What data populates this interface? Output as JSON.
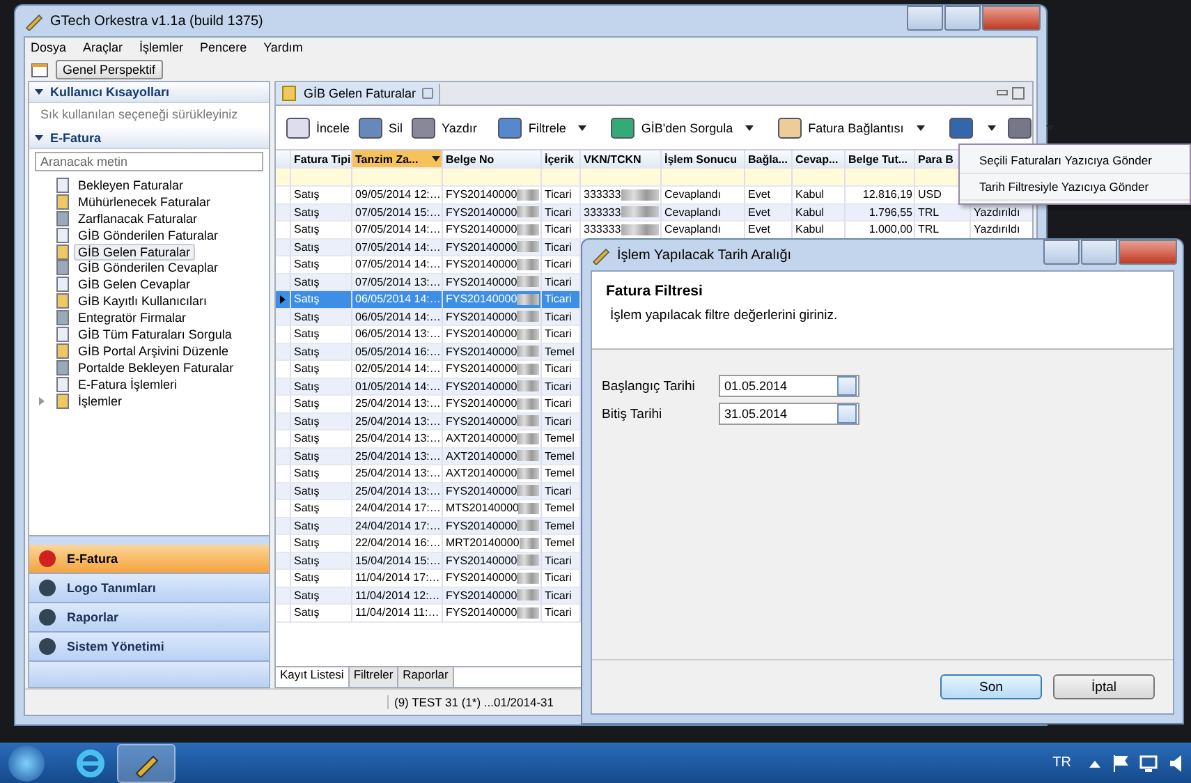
{
  "main_window": {
    "title": "GTech Orkestra v1.1a (build 1375)",
    "menu": [
      "Dosya",
      "Araçlar",
      "İşlemler",
      "Pencere",
      "Yardım"
    ],
    "perspective_button": "Genel Perspektif",
    "sidebar": {
      "shortcuts": {
        "title": "Kullanıcı Kısayolları",
        "expanded": true,
        "hint": "Sık kullanılan seçeneği sürükleyiniz"
      },
      "efatura": {
        "title": "E-Fatura",
        "expanded": true,
        "search": {
          "placeholder": "Aranacak metin"
        },
        "items": [
          {
            "label": "Bekleyen Faturalar",
            "selected": false
          },
          {
            "label": "Mühürlenecek Faturalar",
            "selected": false
          },
          {
            "label": "Zarflanacak Faturalar",
            "selected": false
          },
          {
            "label": "GİB Gönderilen Faturalar",
            "selected": false
          },
          {
            "label": "GİB Gelen Faturalar",
            "selected": true
          },
          {
            "label": "GİB Gönderilen Cevaplar",
            "selected": false
          },
          {
            "label": "GİB Gelen Cevaplar",
            "selected": false
          },
          {
            "label": "GİB Kayıtlı Kullanıcıları",
            "selected": false
          },
          {
            "label": "Entegratör Firmalar",
            "selected": false
          },
          {
            "label": "GİB Tüm Faturaları Sorgula",
            "selected": false
          },
          {
            "label": "GİB Portal Arşivini Düzenle",
            "selected": false
          },
          {
            "label": "Portalde Bekleyen Faturalar",
            "selected": false
          },
          {
            "label": "E-Fatura İşlemleri",
            "selected": false
          },
          {
            "label": "İşlemler",
            "selected": false,
            "kind": "folder",
            "expanded": false
          }
        ]
      },
      "nav_buttons": [
        {
          "label": "E-Fatura",
          "selected": true
        },
        {
          "label": "Logo Tanımları",
          "selected": false
        },
        {
          "label": "Raporlar",
          "selected": false
        },
        {
          "label": "Sistem Yönetimi",
          "selected": false
        }
      ]
    },
    "editor_tab": {
      "label": "GİB Gelen Faturalar"
    },
    "toolbar": [
      {
        "label": "İncele",
        "dropdown": false
      },
      {
        "label": "Sil",
        "dropdown": false
      },
      {
        "label": "Yazdır",
        "dropdown": false
      },
      {
        "label": "Filtrele",
        "dropdown": true
      },
      {
        "label": "GİB'den Sorgula",
        "dropdown": true
      },
      {
        "label": "Fatura Bağlantısı",
        "dropdown": true
      },
      {
        "dropdown": true
      },
      {
        "dropdown": true
      }
    ],
    "table": {
      "columns": [
        {
          "label": "Fatura Tipi",
          "sorted": false
        },
        {
          "label": "Tanzim Za...",
          "sorted": true
        },
        {
          "label": "Belge No",
          "sorted": false,
          "kind": "redacted"
        },
        {
          "label": "İçerik",
          "sorted": false
        },
        {
          "label": "VKN/TCKN",
          "sorted": false,
          "kind": "redacted"
        },
        {
          "label": "İşlem Sonucu",
          "sorted": false
        },
        {
          "label": "Bağla...",
          "sorted": false
        },
        {
          "label": "Cevap...",
          "sorted": false
        },
        {
          "label": "Belge Tut...",
          "sorted": false,
          "kind": "number"
        },
        {
          "label": "Para B",
          "sorted": false
        }
      ],
      "rows": [
        {
          "selected": false,
          "cells": [
            "Satış",
            "09/05/2014 12:…",
            "FYS20140000",
            "Ticari",
            "333333",
            "Cevaplandı",
            "Evet",
            "Kabul",
            "12.816,19",
            "USD"
          ]
        },
        {
          "selected": false,
          "cells": [
            "Satış",
            "07/05/2014 15:…",
            "FYS20140000",
            "Ticari",
            "333333",
            "Cevaplandı",
            "Evet",
            "Kabul",
            "1.796,55",
            "TRL",
            "Yazdırıldı"
          ]
        },
        {
          "selected": false,
          "cells": [
            "Satış",
            "07/05/2014 14:…",
            "FYS20140000",
            "Ticari",
            "333333",
            "Cevaplandı",
            "Evet",
            "Kabul",
            "1.000,00",
            "TRL",
            "Yazdırıldı"
          ]
        },
        {
          "selected": false,
          "cells": [
            "Satış",
            "07/05/2014 14:…",
            "FYS20140000",
            "Ticari"
          ]
        },
        {
          "selected": false,
          "cells": [
            "Satış",
            "07/05/2014 14:…",
            "FYS20140000",
            "Ticari"
          ]
        },
        {
          "selected": false,
          "cells": [
            "Satış",
            "07/05/2014 13:…",
            "FYS20140000",
            "Ticari"
          ]
        },
        {
          "selected": true,
          "cells": [
            "Satış",
            "06/05/2014 14:…",
            "FYS20140000",
            "Ticari"
          ]
        },
        {
          "selected": false,
          "cells": [
            "Satış",
            "06/05/2014 14:…",
            "FYS20140000",
            "Ticari"
          ]
        },
        {
          "selected": false,
          "cells": [
            "Satış",
            "06/05/2014 13:…",
            "FYS20140000",
            "Ticari"
          ]
        },
        {
          "selected": false,
          "cells": [
            "Satış",
            "05/05/2014 16:…",
            "FYS20140000",
            "Temel"
          ]
        },
        {
          "selected": false,
          "cells": [
            "Satış",
            "02/05/2014 14:…",
            "FYS20140000",
            "Ticari"
          ]
        },
        {
          "selected": false,
          "cells": [
            "Satış",
            "01/05/2014 14:…",
            "FYS20140000",
            "Ticari"
          ]
        },
        {
          "selected": false,
          "cells": [
            "Satış",
            "25/04/2014 13:…",
            "FYS20140000",
            "Ticari"
          ]
        },
        {
          "selected": false,
          "cells": [
            "Satış",
            "25/04/2014 13:…",
            "FYS20140000",
            "Ticari"
          ]
        },
        {
          "selected": false,
          "cells": [
            "Satış",
            "25/04/2014 13:…",
            "AXT20140000",
            "Temel"
          ]
        },
        {
          "selected": false,
          "cells": [
            "Satış",
            "25/04/2014 13:…",
            "AXT20140000",
            "Temel"
          ]
        },
        {
          "selected": false,
          "cells": [
            "Satış",
            "25/04/2014 13:…",
            "AXT20140000",
            "Temel"
          ]
        },
        {
          "selected": false,
          "cells": [
            "Satış",
            "25/04/2014 13:…",
            "FYS20140000",
            "Ticari"
          ]
        },
        {
          "selected": false,
          "cells": [
            "Satış",
            "24/04/2014 17:…",
            "MTS20140000",
            "Temel"
          ]
        },
        {
          "selected": false,
          "cells": [
            "Satış",
            "24/04/2014 17:…",
            "FYS20140000",
            "Temel"
          ]
        },
        {
          "selected": false,
          "cells": [
            "Satış",
            "22/04/2014 16:…",
            "MRT20140000",
            "Temel"
          ]
        },
        {
          "selected": false,
          "cells": [
            "Satış",
            "15/04/2014 15:…",
            "FYS20140000",
            "Ticari"
          ]
        },
        {
          "selected": false,
          "cells": [
            "Satış",
            "11/04/2014 17:…",
            "FYS20140000",
            "Ticari"
          ]
        },
        {
          "selected": false,
          "cells": [
            "Satış",
            "11/04/2014 12:…",
            "FYS20140000",
            "Ticari"
          ]
        },
        {
          "selected": false,
          "cells": [
            "Satış",
            "11/04/2014 11:…",
            "FYS20140000",
            "Ticari"
          ]
        }
      ]
    },
    "bottom_tabs": [
      {
        "label": "Kayıt Listesi",
        "selected": true
      },
      {
        "label": "Filtreler",
        "selected": false
      },
      {
        "label": "Raporlar",
        "selected": false
      }
    ],
    "status_bar": "(9) TEST 31  (1*) ...01/2014-31"
  },
  "context_menu": [
    "Seçili Faturaları Yazıcıya Gönder",
    "Tarih Filtresiyle Yazıcıya Gönder"
  ],
  "dialog": {
    "title": "İşlem Yapılacak Tarih Aralığı",
    "heading": "Fatura Filtresi",
    "description": "İşlem yapılacak filtre değerlerini giriniz.",
    "fields": [
      {
        "label": "Başlangıç Tarihi",
        "value": "01.05.2014"
      },
      {
        "label": "Bitiş Tarihi",
        "value": "31.05.2014"
      }
    ],
    "buttons": [
      {
        "label": "Son",
        "default": true
      },
      {
        "label": "İptal",
        "default": false
      }
    ]
  },
  "taskbar": {
    "language": "TR"
  }
}
